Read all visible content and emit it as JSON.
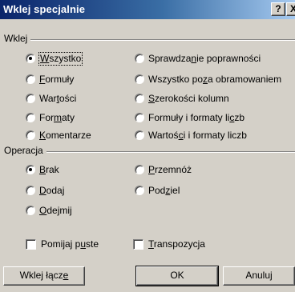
{
  "window": {
    "title": "Wklej specjalnie",
    "help": "?",
    "close": "X"
  },
  "wklej": {
    "label": "Wklej",
    "left": [
      {
        "pre": "",
        "u": "W",
        "post": "szystko",
        "checked": true
      },
      {
        "pre": "",
        "u": "F",
        "post": "ormuły",
        "checked": false
      },
      {
        "pre": "War",
        "u": "t",
        "post": "ości",
        "checked": false
      },
      {
        "pre": "For",
        "u": "m",
        "post": "aty",
        "checked": false
      },
      {
        "pre": "",
        "u": "K",
        "post": "omentarze",
        "checked": false
      }
    ],
    "right": [
      {
        "pre": "Sprawdza",
        "u": "n",
        "post": "ie poprawności",
        "checked": false
      },
      {
        "pre": "Wszystko po",
        "u": "z",
        "post": "a obramowaniem",
        "checked": false
      },
      {
        "pre": "",
        "u": "S",
        "post": "zerokości kolumn",
        "checked": false
      },
      {
        "pre": "Formuły i formaty li",
        "u": "c",
        "post": "zb",
        "checked": false
      },
      {
        "pre": "Wartoś",
        "u": "c",
        "post": "i i formaty liczb",
        "checked": false
      }
    ]
  },
  "operacja": {
    "label": "Operacja",
    "left": [
      {
        "pre": "",
        "u": "B",
        "post": "rak",
        "checked": true
      },
      {
        "pre": "",
        "u": "D",
        "post": "odaj",
        "checked": false
      },
      {
        "pre": "",
        "u": "O",
        "post": "dejmij",
        "checked": false
      }
    ],
    "right": [
      {
        "pre": "",
        "u": "P",
        "post": "rzemnóż",
        "checked": false
      },
      {
        "pre": "Pod",
        "u": "z",
        "post": "iel",
        "checked": false
      }
    ]
  },
  "options": {
    "skip_blanks": {
      "pre": "Pomijaj p",
      "u": "u",
      "post": "ste",
      "checked": false
    },
    "transpose": {
      "pre": "",
      "u": "T",
      "post": "ranspozycja",
      "checked": false
    }
  },
  "buttons": {
    "paste_link": {
      "pre": "Wklej łącz",
      "u": "e",
      "post": ""
    },
    "ok": "OK",
    "cancel": "Anuluj"
  }
}
